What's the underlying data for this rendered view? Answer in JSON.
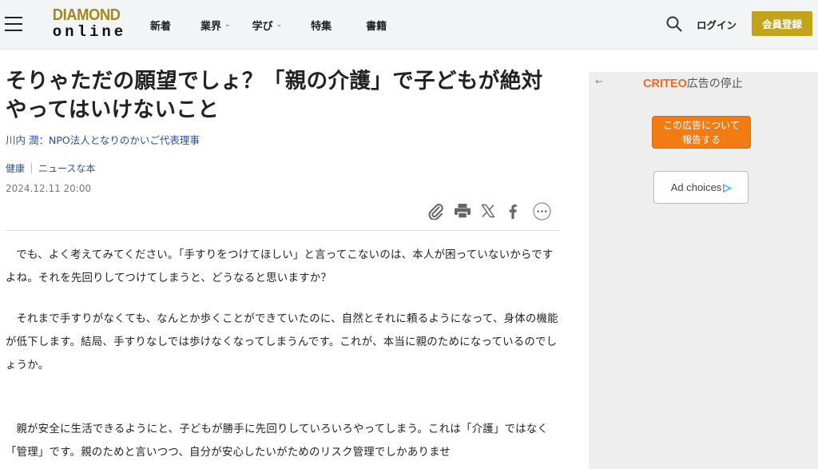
{
  "header": {
    "logo_top": "DIAMOND",
    "logo_bottom": "online",
    "nav": [
      {
        "label": "新着",
        "has_dropdown": false
      },
      {
        "label": "業界",
        "has_dropdown": true
      },
      {
        "label": "学び",
        "has_dropdown": true
      },
      {
        "label": "特集",
        "has_dropdown": false
      },
      {
        "label": "書籍",
        "has_dropdown": false
      }
    ],
    "dropdown_glyph": "⌄",
    "login_label": "ログイン",
    "register_label": "会員登録",
    "accent_color": "#c3a31a"
  },
  "article": {
    "title": "そりゃただの願望でしょ？「親の介護」で子どもが絶対やってはいけないこと",
    "author": "川内 潤：NPO法人となりのかいご代表理事",
    "tags": [
      "健康",
      "ニュースな本"
    ],
    "date": "2024.12.11 20:00",
    "share_icons": [
      "clip-icon",
      "print-icon",
      "x-icon",
      "facebook-icon",
      "more-icon"
    ],
    "paragraphs": [
      "でも、よく考えてみてください。「手すりをつけてほしい」と言ってこないのは、本人が困っていないからですよね。それを先回りしてつけてしまうと、どうなると思いますか？",
      "それまで手すりがなくても、なんとか歩くことができていたのに、自然とそれに頼るようになって、身体の機能が低下します。結局、手すりなしでは歩けなくなってしまうんです。これが、本当に親のためになっているのでしょうか。",
      "親が安全に生活できるようにと、子どもが勝手に先回りしていろいろやってしまう。これは「介護」ではなく「管理」です。親のためと言いつつ、自分が安心したいがためのリスク管理でしかありませ"
    ]
  },
  "ad": {
    "back_glyph": "←",
    "brand": "CRITEO",
    "stop_label": "広告の停止",
    "report_label_1": "この広告について",
    "report_label_2": "報告する",
    "choices_label": "Ad choices",
    "choices_glyph": "▷",
    "brand_color": "#f26b1d"
  }
}
